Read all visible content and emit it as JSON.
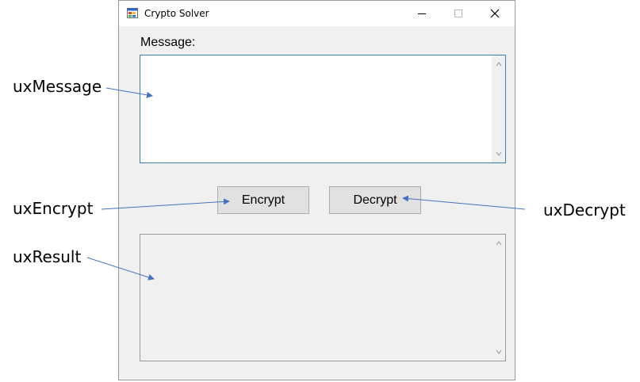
{
  "window": {
    "title": "Crypto Solver",
    "controls": {
      "minimize": "minimize-icon",
      "maximize": "maximize-icon",
      "close": "close-icon"
    }
  },
  "form": {
    "message_label": "Message:",
    "message_value": "",
    "result_value": "",
    "encrypt_label": "Encrypt",
    "decrypt_label": "Decrypt"
  },
  "annotations": {
    "message": "uxMessage",
    "encrypt": "uxEncrypt",
    "decrypt": "uxDecrypt",
    "result": "uxResult"
  },
  "colors": {
    "window_bg": "#f0f0f0",
    "focus_border": "#3c7fb1",
    "button_bg": "#e1e1e1",
    "arrow": "#4472c4"
  }
}
